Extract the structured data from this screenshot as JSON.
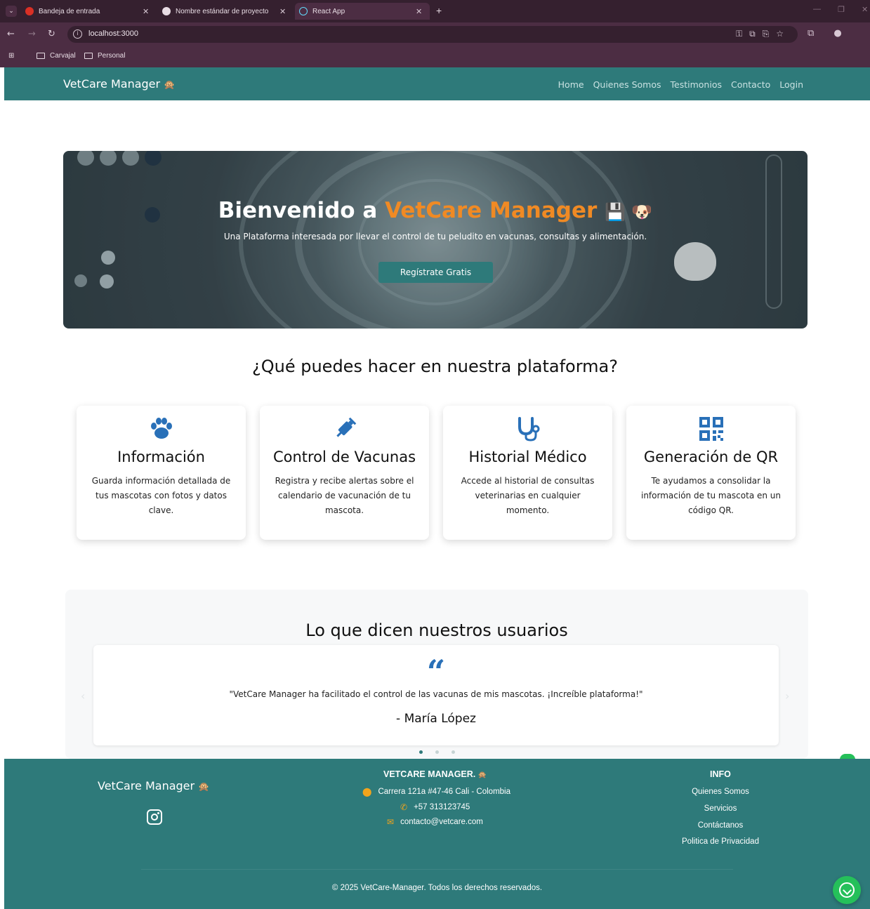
{
  "browser": {
    "tabs": [
      {
        "title": "Bandeja de entrada",
        "icon": "gmail-icon"
      },
      {
        "title": "Nombre estándar de proyecto",
        "icon": "globe-icon"
      },
      {
        "title": "React App",
        "icon": "react-icon"
      }
    ],
    "url": "localhost:3000",
    "bookmarks": [
      "Carvajal",
      "Personal"
    ]
  },
  "navbar": {
    "brand": "VetCare Manager",
    "brand_emoji": "🙊",
    "links": [
      "Home",
      "Quienes Somos",
      "Testimonios",
      "Contacto",
      "Login"
    ]
  },
  "hero": {
    "title_prefix": "Bienvenido a ",
    "title_accent": "VetCare Manager",
    "title_emojis": "💾 🐶",
    "subtitle": "Una Plataforma interesada por llevar el control de tu peludito en vacunas, consultas y alimentación.",
    "cta": "Regístrate Gratis"
  },
  "features": {
    "title": "¿Qué puedes hacer en nuestra plataforma?",
    "cards": [
      {
        "icon": "paw-icon",
        "title": "Información",
        "desc": "Guarda información detallada de tus mascotas con fotos y datos clave."
      },
      {
        "icon": "syringe-icon",
        "title": "Control de Vacunas",
        "desc": "Registra y recibe alertas sobre el calendario de vacunación de tu mascota."
      },
      {
        "icon": "stethoscope-icon",
        "title": "Historial Médico",
        "desc": "Accede al historial de consultas veterinarias en cualquier momento."
      },
      {
        "icon": "qr-code-icon",
        "title": "Generación de QR",
        "desc": "Te ayudamos a consolidar la información de tu mascota en un código QR."
      }
    ]
  },
  "testimonials": {
    "title": "Lo que dicen nuestros usuarios",
    "quote": "\"VetCare Manager ha facilitado el control de las vacunas de mis mascotas. ¡Increíble plataforma!\"",
    "author": "- María López",
    "active_index": 0,
    "total": 3
  },
  "footer": {
    "brand": "VetCare Manager",
    "brand_emoji": "🙊",
    "company_title": "VETCARE MANAGER.",
    "company_emoji": "🙊",
    "address": "Carrera 121a #47-46 Cali - Colombia",
    "phone": "+57 313123745",
    "email": "contacto@vetcare.com",
    "info_title": "INFO",
    "info_links": [
      "Quienes Somos",
      "Servicios",
      "Contáctanos",
      "Politica de Privacidad"
    ],
    "copyright": "© 2025 VetCare-Manager. Todos los derechos reservados."
  },
  "colors": {
    "primary": "#2e7a7a",
    "accent": "#f08a24",
    "icon_blue": "#2970b8",
    "whatsapp": "#25c05a"
  }
}
